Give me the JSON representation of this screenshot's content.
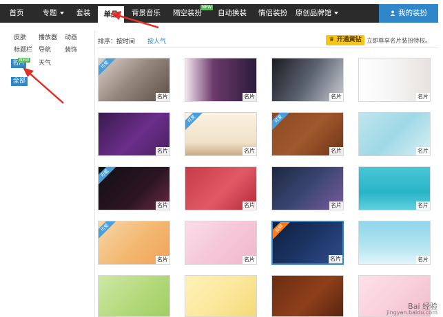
{
  "nav": {
    "items": [
      "首页",
      "专题",
      "套装",
      "单品",
      "背景音乐",
      "隔空装扮",
      "自动换装",
      "情侣装扮",
      "原创品牌馆"
    ],
    "new_badge": "NEW",
    "mine_label": "我的装扮"
  },
  "sidebar": {
    "tags": [
      "皮肤",
      "播放器",
      "动画",
      "标题栏",
      "导航",
      "装饰",
      "名片",
      "天气"
    ],
    "new_badge": "NEW",
    "all_label": "全部"
  },
  "sort": {
    "label": "排序：",
    "by_time": "按时间",
    "by_popularity": "按人气"
  },
  "vip": {
    "button": "开通黄钻",
    "text": "立即尊享名片装扮特权。"
  },
  "grid": {
    "card_label": "名片",
    "ribbon_free": "可爱",
    "ribbon_hot": "抢鲜"
  },
  "watermark": {
    "brand": "Bai 经验",
    "url": "jingyan.baidu.com"
  },
  "colors": {
    "nav_bg": "#2b2b2b",
    "accent": "#2f86c9",
    "vip": "#f5c518",
    "annotation": "#e0302a"
  }
}
